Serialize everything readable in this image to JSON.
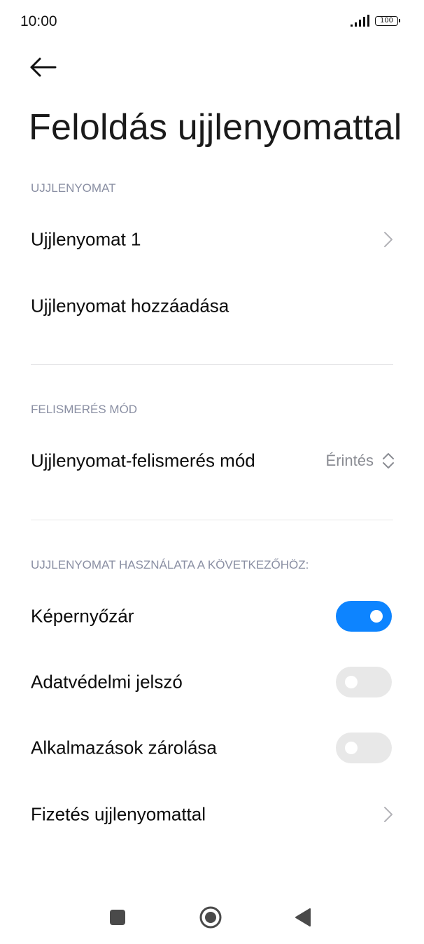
{
  "status_bar": {
    "time": "10:00",
    "battery": "100",
    "signal_icon": "signal-bars-icon"
  },
  "header": {
    "back_icon": "arrow-left-icon",
    "title": "Feloldás ujjlenyomattal"
  },
  "sections": {
    "fingerprint": {
      "header": "UJJLENYOMAT",
      "items": [
        {
          "label": "Ujjlenyomat 1",
          "icon": "chevron-right-icon"
        },
        {
          "label": "Ujjlenyomat hozzáadása"
        }
      ]
    },
    "recognition": {
      "header": "FELISMERÉS MÓD",
      "item": {
        "label": "Ujjlenyomat-felismerés mód",
        "value": "Érintés",
        "icon": "chevron-up-down-icon"
      }
    },
    "usage": {
      "header": "UJJLENYOMAT HASZNÁLATA A KÖVETKEZŐHÖZ:",
      "items": [
        {
          "label": "Képernyőzár",
          "toggle": true
        },
        {
          "label": "Adatvédelmi jelszó",
          "toggle": false
        },
        {
          "label": "Alkalmazások zárolása",
          "toggle": false
        },
        {
          "label": "Fizetés ujjlenyomattal",
          "icon": "chevron-right-icon"
        }
      ]
    }
  },
  "nav_bar": {
    "recents_icon": "square-icon",
    "home_icon": "circle-home-icon",
    "back_icon": "triangle-back-icon"
  },
  "colors": {
    "accent": "#0d84ff",
    "toggle_off": "#e8e8e8",
    "section_header": "#8a8fa3",
    "divider": "#e6e6e8"
  }
}
